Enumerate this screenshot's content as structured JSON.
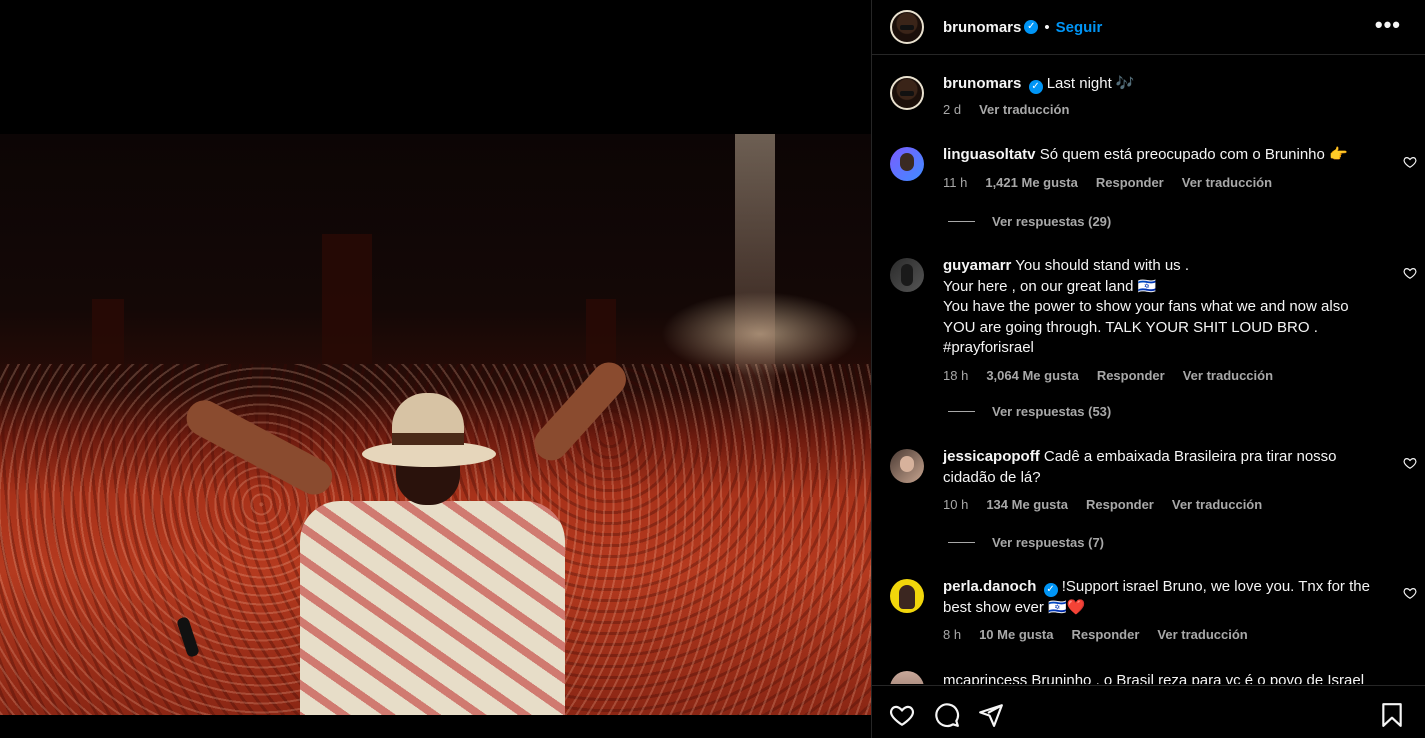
{
  "post": {
    "author": "brunomars",
    "verified": true,
    "follow_label": "Seguir",
    "more_label": "•••"
  },
  "caption": {
    "username": "brunomars",
    "text": "Last night",
    "emoji": "🎶",
    "age": "2 d",
    "translate_label": "Ver traducción"
  },
  "comments": [
    {
      "username": "linguasoltatv",
      "verified": false,
      "text": "Só quem está preocupado com o Bruninho 👉",
      "age": "11 h",
      "likes": "1,421 Me gusta",
      "reply_label": "Responder",
      "translate_label": "Ver traducción",
      "replies_label": "Ver respuestas (29)"
    },
    {
      "username": "guyamarr",
      "verified": false,
      "text_lines": [
        "You should stand with us .",
        "Your here , on our great land 🇮🇱",
        "You have the power to show your fans what we and now also",
        "YOU are going through. TALK YOUR SHIT LOUD BRO .",
        "#prayforisrael"
      ],
      "age": "18 h",
      "likes": "3,064 Me gusta",
      "reply_label": "Responder",
      "translate_label": "Ver traducción",
      "replies_label": "Ver respuestas (53)"
    },
    {
      "username": "jessicapopoff",
      "verified": false,
      "text_lines": [
        "Cadê a embaixada Brasileira pra tirar nosso",
        "cidadão de lá?"
      ],
      "age": "10 h",
      "likes": "134 Me gusta",
      "reply_label": "Responder",
      "translate_label": "Ver traducción",
      "replies_label": "Ver respuestas (7)"
    },
    {
      "username": "perla.danoch",
      "verified": true,
      "text_lines": [
        "!Support israel Bruno, we love you. Tnx for the",
        "best show ever 🇮🇱❤️"
      ],
      "age": "8 h",
      "likes": "10 Me gusta",
      "reply_label": "Responder",
      "translate_label": "Ver traducción"
    }
  ],
  "truncated_comment": "mcaprincess Bruninho , o Brasil reza para vc é o povo de Israel",
  "actions": [
    "like-icon",
    "comment-icon",
    "share-icon",
    "save-icon"
  ],
  "colors": {
    "accent": "#0095f6",
    "background": "#000000",
    "muted": "#a8a8a8",
    "heart": "#ed4956"
  }
}
